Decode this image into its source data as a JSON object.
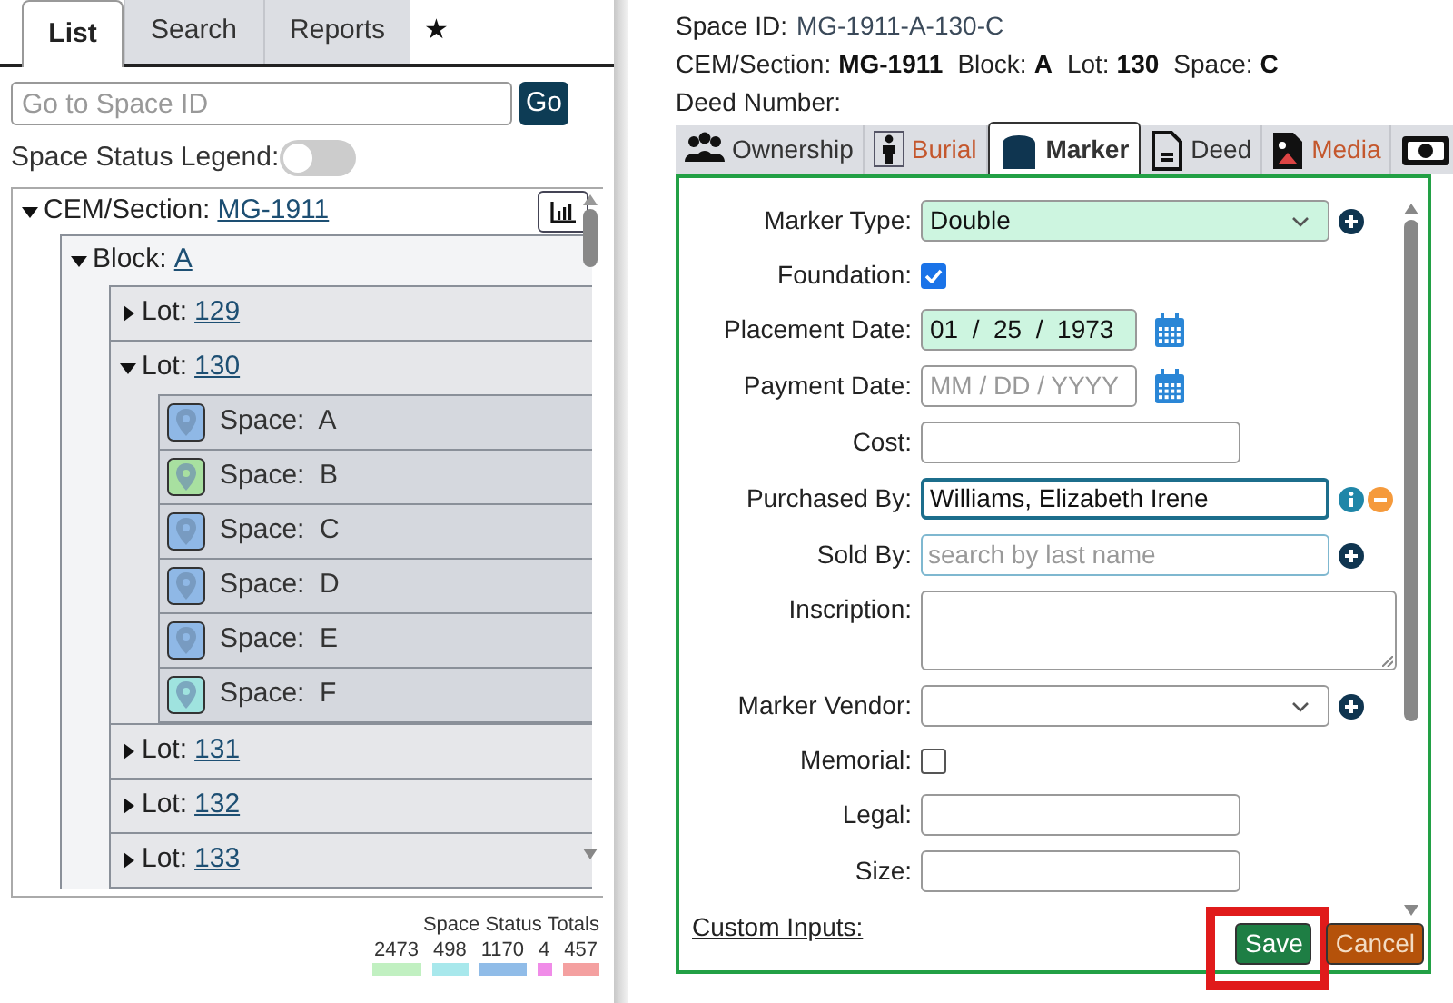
{
  "left_tabs": [
    {
      "label": "List",
      "selected": true
    },
    {
      "label": "Search",
      "selected": false
    },
    {
      "label": "Reports",
      "selected": false
    },
    {
      "label": "★",
      "selected": false
    }
  ],
  "goto": {
    "placeholder": "Go to Space ID",
    "button": "Go"
  },
  "legend": {
    "label": "Space Status Legend:",
    "on": false
  },
  "tree": {
    "label": "CEM/Section:",
    "link": "MG-1911",
    "expanded": true,
    "children": [
      {
        "label": "Block:",
        "link": "A",
        "expanded": true,
        "children": [
          {
            "label": "Lot:",
            "link": "129",
            "expanded": false
          },
          {
            "label": "Lot:",
            "link": "130",
            "expanded": true,
            "children": [
              {
                "kind": "space",
                "label": "Space:",
                "value": "A",
                "color": "#8fb8e6"
              },
              {
                "kind": "space",
                "label": "Space:",
                "value": "B",
                "color": "#a8e0a0"
              },
              {
                "kind": "space",
                "label": "Space:",
                "value": "C",
                "color": "#8fb8e6"
              },
              {
                "kind": "space",
                "label": "Space:",
                "value": "D",
                "color": "#8fb8e6"
              },
              {
                "kind": "space",
                "label": "Space:",
                "value": "E",
                "color": "#8fb8e6"
              },
              {
                "kind": "space",
                "label": "Space:",
                "value": "F",
                "color": "#9fe3df"
              }
            ]
          },
          {
            "label": "Lot:",
            "link": "131",
            "expanded": false
          },
          {
            "label": "Lot:",
            "link": "132",
            "expanded": false
          },
          {
            "label": "Lot:",
            "link": "133",
            "expanded": false
          }
        ]
      }
    ]
  },
  "totals": {
    "title": "Space Status Totals",
    "items": [
      {
        "count": "2473",
        "color": "#c1f0c1"
      },
      {
        "count": "498",
        "color": "#a8e8ec"
      },
      {
        "count": "1170",
        "color": "#90bce8"
      },
      {
        "count": "4",
        "color": "#f08ce8"
      },
      {
        "count": "457",
        "color": "#f4a0a0"
      }
    ]
  },
  "header": {
    "space_id_label": "Space ID:",
    "space_id": "MG-1911-A-130-C",
    "parts": [
      {
        "label": "CEM/Section:",
        "value": "MG-1911"
      },
      {
        "label": "Block:",
        "value": "A"
      },
      {
        "label": "Lot:",
        "value": "130"
      },
      {
        "label": "Space:",
        "value": "C"
      }
    ],
    "deed_label": "Deed Number:"
  },
  "tabs": [
    {
      "kind": "people",
      "label": "Ownership",
      "selected": false,
      "color": "#333333"
    },
    {
      "kind": "person",
      "label": "Burial",
      "selected": false,
      "color": "#c4572d"
    },
    {
      "kind": "marker",
      "label": "Marker",
      "selected": true,
      "color": "#333333"
    },
    {
      "kind": "document",
      "label": "Deed",
      "selected": false,
      "color": "#333333"
    },
    {
      "kind": "media",
      "label": "Media",
      "selected": false,
      "color": "#c4572d"
    },
    {
      "kind": "cash",
      "selected": false
    }
  ],
  "fields": [
    {
      "kind": "select",
      "label": "Marker Type:",
      "value": "Double",
      "valid": true,
      "actions": [
        {
          "kind": "add"
        }
      ]
    },
    {
      "kind": "checkbox",
      "label": "Foundation:",
      "checked": true
    },
    {
      "kind": "date",
      "label": "Placement Date:",
      "value": "01  /  25  /  1973",
      "valid": true
    },
    {
      "kind": "date",
      "label": "Payment Date:",
      "placeholder": "MM / DD / YYYY",
      "valid": false
    },
    {
      "kind": "text",
      "label": "Cost:"
    },
    {
      "kind": "person",
      "label": "Purchased By:",
      "value": "Williams, Elizabeth Irene",
      "focused": true,
      "actions": [
        {
          "kind": "info"
        },
        {
          "kind": "remove"
        }
      ]
    },
    {
      "kind": "person",
      "label": "Sold By:",
      "placeholder": "search by last name",
      "focused": false,
      "actions": [
        {
          "kind": "add"
        }
      ]
    },
    {
      "kind": "textarea",
      "label": "Inscription:"
    },
    {
      "kind": "select",
      "label": "Marker Vendor:",
      "valid": false,
      "actions": [
        {
          "kind": "add"
        }
      ]
    },
    {
      "kind": "checkbox",
      "label": "Memorial:",
      "checked": false
    },
    {
      "kind": "text",
      "label": "Legal:"
    },
    {
      "kind": "text",
      "label": "Size:"
    }
  ],
  "custom_inputs": "Custom Inputs:",
  "buttons": [
    {
      "kind": "save",
      "label": "Save",
      "highlighted": true
    },
    {
      "kind": "cancel",
      "label": "Cancel",
      "highlighted": false
    }
  ]
}
